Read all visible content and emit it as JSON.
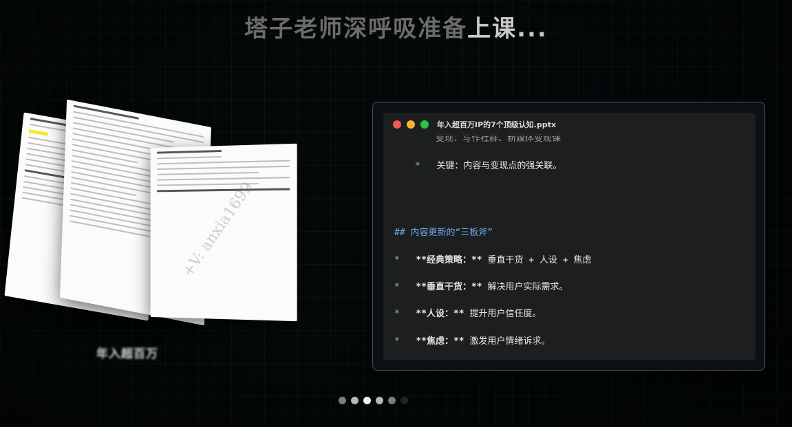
{
  "headline": {
    "text_dim": "塔子老师深呼吸准备",
    "text_bright": "上课..."
  },
  "document_stack": {
    "watermark": "+V: anxia1699",
    "caption": "年入超百万"
  },
  "editor": {
    "window_title": "年入超百万IP的7个顶级认知.pptx",
    "lines": {
      "partial_top": "变现：写作社群、新媒体变现课",
      "key_bullet": "*",
      "key_text": "关键：内容与变现点的强关联。",
      "heading": "## 内容更新的“三板斧”",
      "b1_bullet": "*",
      "b1_bold": "**经典策略：**",
      "b1_text": "垂直干货 + 人设 + 焦虑",
      "b2_bullet": "*",
      "b2_bold": "**垂直干货：**",
      "b2_text": "解决用户实际需求。",
      "b3_bullet": "*",
      "b3_bold": "**人设：**",
      "b3_text": "提升用户信任度。",
      "b4_bullet": "*",
      "b4_bold": "**焦虑：**",
      "b4_text": "激发用户情绪诉求。"
    }
  },
  "pager": {
    "count": 6,
    "active_index": 2
  },
  "colors": {
    "background": "#040809",
    "bullet": "#8dc86c",
    "heading": "#6fa5e6",
    "dot_red": "#f05a55",
    "dot_yellow": "#f3b630",
    "dot_green": "#2ec24a"
  }
}
